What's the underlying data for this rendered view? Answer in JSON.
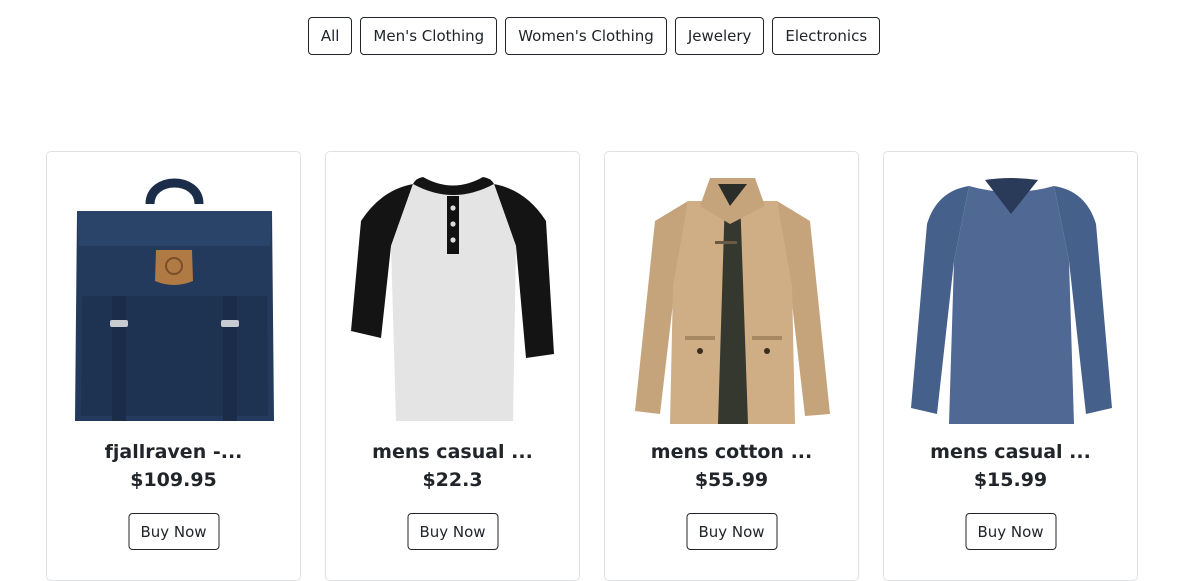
{
  "filters": [
    "All",
    "Men's Clothing",
    "Women's Clothing",
    "Jewelery",
    "Electronics"
  ],
  "products": [
    {
      "title": "fjallraven -...",
      "price": "$109.95",
      "button": "Buy Now",
      "image": "navy-backpack"
    },
    {
      "title": "mens casual ...",
      "price": "$22.3",
      "button": "Buy Now",
      "image": "raglan-henley-shirt"
    },
    {
      "title": "mens cotton ...",
      "price": "$55.99",
      "button": "Buy Now",
      "image": "khaki-cotton-jacket"
    },
    {
      "title": "mens casual ...",
      "price": "$15.99",
      "button": "Buy Now",
      "image": "blue-long-sleeve-tee"
    }
  ],
  "colors": {
    "text": "#212529",
    "card_border": "#dfe1e3",
    "backpack": "#233a5c",
    "jacket": "#cfae86",
    "tee": "#4f6894"
  }
}
